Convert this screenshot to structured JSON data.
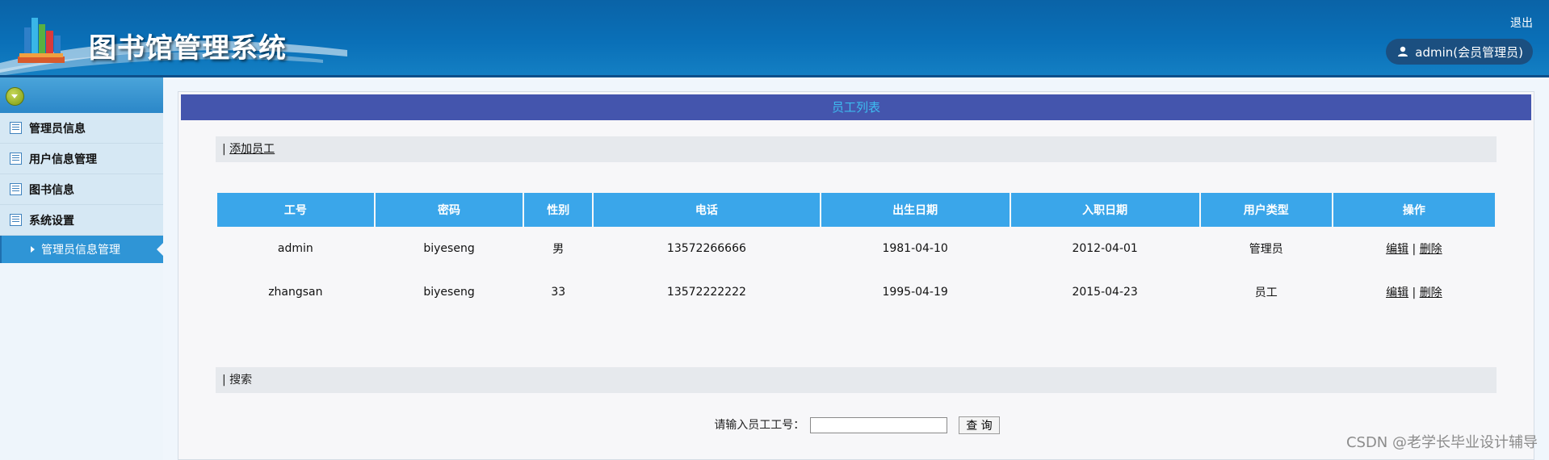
{
  "header": {
    "title": "图书馆管理系统",
    "logout_label": "退出",
    "user_label": "admin(会员管理员)",
    "colors": {
      "bar": "#0a6ab0"
    }
  },
  "sidebar": {
    "toggle_icon": "chevron-down-icon",
    "items": [
      {
        "label": "管理员信息",
        "icon": "list-icon"
      },
      {
        "label": "用户信息管理",
        "icon": "list-icon"
      },
      {
        "label": "图书信息",
        "icon": "list-icon"
      },
      {
        "label": "系统设置",
        "icon": "list-icon"
      }
    ],
    "active_sub": {
      "label": "管理员信息管理"
    }
  },
  "main": {
    "panel_title": "员工列表",
    "add_bar": {
      "prefix": "| ",
      "link": "添加员工"
    },
    "table": {
      "columns": [
        "工号",
        "密码",
        "性别",
        "电话",
        "出生日期",
        "入职日期",
        "用户类型",
        "操作"
      ],
      "rows": [
        {
          "id": "admin",
          "password": "biyeseng",
          "gender": "男",
          "phone": "13572266666",
          "birth": "1981-04-10",
          "hired": "2012-04-01",
          "type": "管理员",
          "edit": "编辑",
          "sep": "|",
          "delete": "删除"
        },
        {
          "id": "zhangsan",
          "password": "biyeseng",
          "gender": "33",
          "phone": "13572222222",
          "birth": "1995-04-19",
          "hired": "2015-04-23",
          "type": "员工",
          "edit": "编辑",
          "sep": "|",
          "delete": "删除"
        }
      ]
    },
    "search_bar": {
      "label": "| 搜索"
    },
    "search": {
      "label": "请输入员工工号：",
      "value": "",
      "button": "查 询"
    }
  },
  "watermark": "CSDN @老学长毕业设计辅导",
  "colors": {
    "title_bar": "#4455ad",
    "title_text": "#3dbcf0",
    "table_header": "#3aa6ea"
  }
}
